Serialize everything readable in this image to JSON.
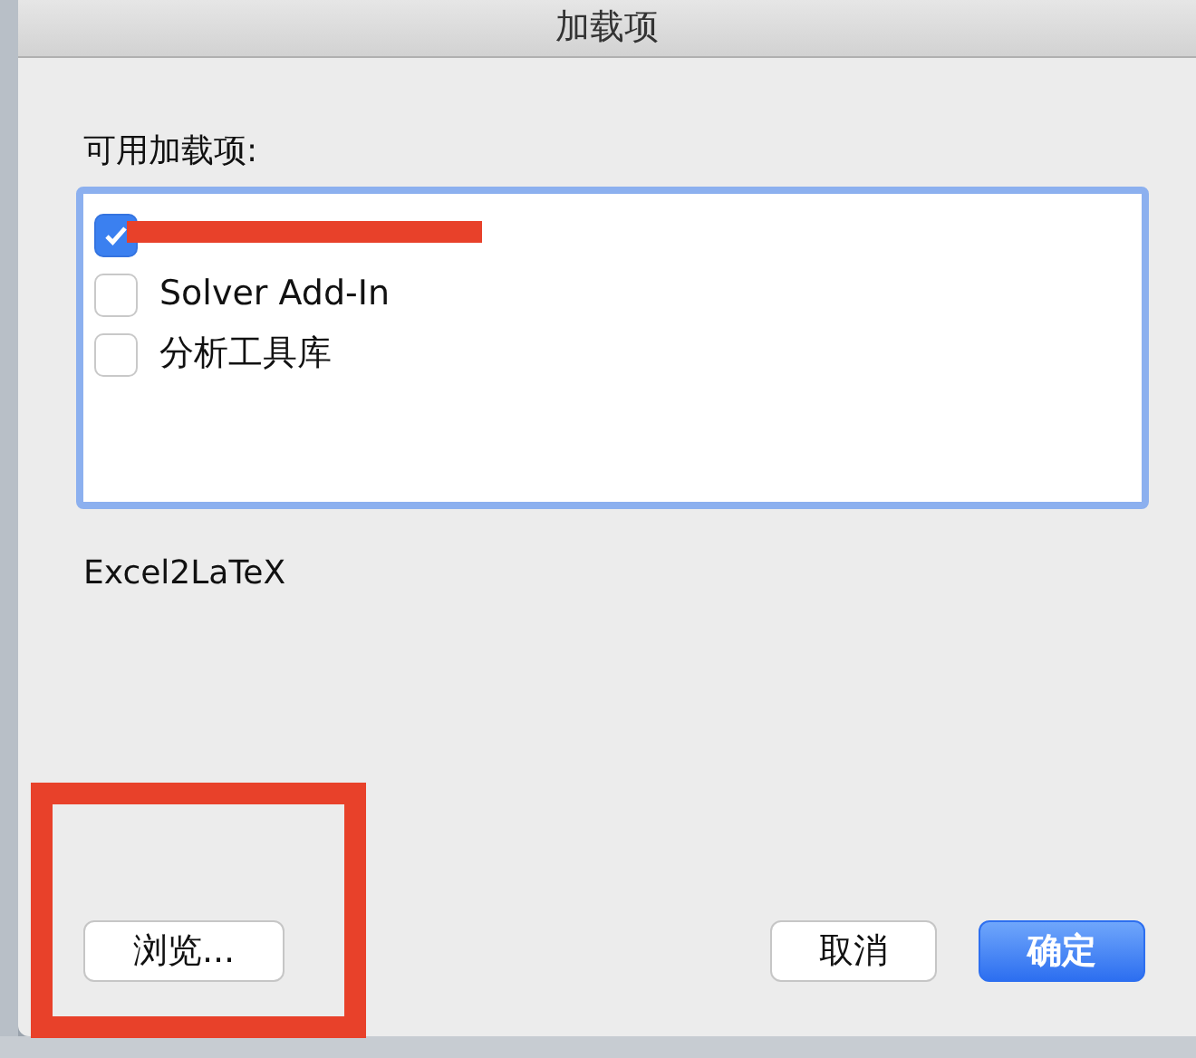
{
  "window": {
    "title": "加载项"
  },
  "list_label": "可用加载项:",
  "addins": [
    {
      "checked": true,
      "redacted": true
    },
    {
      "label": "Solver Add-In",
      "checked": false,
      "redacted": false
    },
    {
      "label": "分析工具库",
      "checked": false,
      "redacted": false
    }
  ],
  "description": "Excel2LaTeX",
  "buttons": [
    {
      "label": "浏览...",
      "kind": "browse",
      "highlighted": true
    },
    {
      "label": "取消",
      "kind": "cancel"
    },
    {
      "label": "确定",
      "kind": "default"
    }
  ]
}
